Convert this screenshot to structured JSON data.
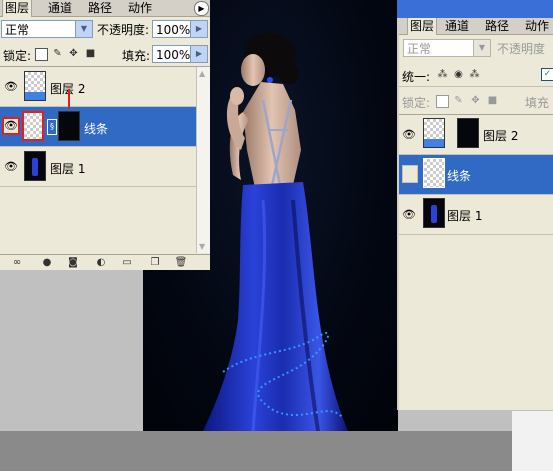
{
  "left_panel": {
    "tabs": [
      {
        "label": "图层",
        "active": true
      },
      {
        "label": "通道",
        "active": false
      },
      {
        "label": "路径",
        "active": false
      },
      {
        "label": "动作",
        "active": false
      }
    ],
    "blend_mode": "正常",
    "opacity_label": "不透明度:",
    "opacity_value": "100%",
    "lock_label": "锁定:",
    "fill_label": "填充:",
    "fill_value": "100%",
    "layers": [
      {
        "name": "图层 2",
        "visible": true,
        "selected": false
      },
      {
        "name": "线条",
        "visible": true,
        "selected": true
      },
      {
        "name": "图层 1",
        "visible": true,
        "selected": false
      }
    ],
    "bottom_icons": [
      "link-icon",
      "fx-icon",
      "mask-icon",
      "adjustment-icon",
      "folder-icon",
      "new-layer-icon",
      "trash-icon"
    ]
  },
  "right_panel": {
    "tabs": [
      {
        "label": "图层",
        "active": true
      },
      {
        "label": "通道",
        "active": false
      },
      {
        "label": "路径",
        "active": false
      },
      {
        "label": "动作",
        "active": false
      }
    ],
    "blend_mode": "正常",
    "opacity_label": "不透明度",
    "unify_label": "统一:",
    "lock_label": "锁定:",
    "fill_label": "填充",
    "layers": [
      {
        "name": "图层 2",
        "visible": true,
        "selected": false
      },
      {
        "name": "线条",
        "visible": false,
        "selected": true
      },
      {
        "name": "图层 1",
        "visible": true,
        "selected": false
      }
    ]
  },
  "colors": {
    "selection_blue": "#316ac5",
    "panel_bg": "#ece9d8",
    "dress_blue": "#1c2fb0",
    "highlight_red": "#e0201c"
  }
}
